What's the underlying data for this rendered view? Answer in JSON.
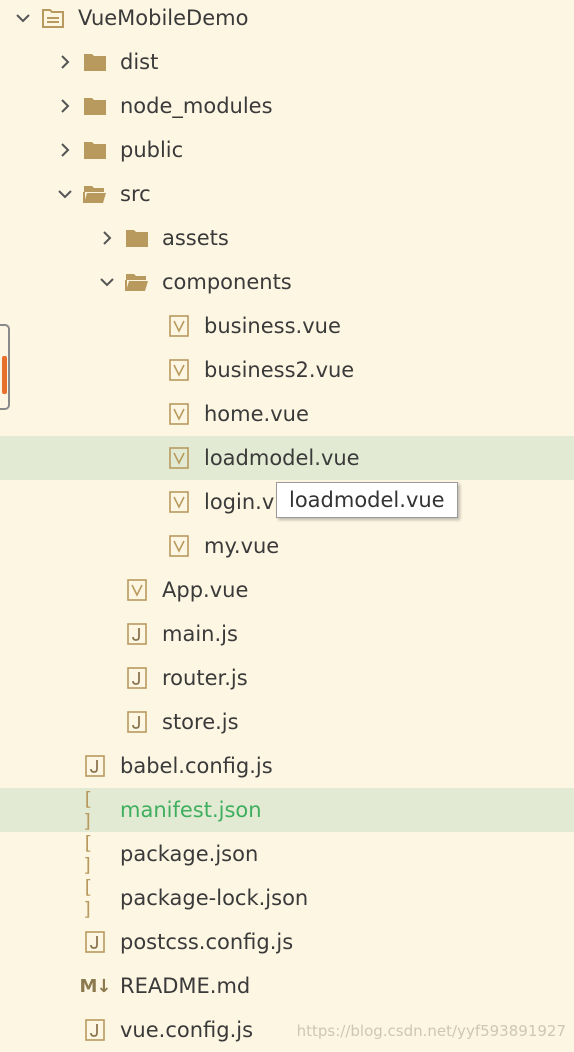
{
  "explorer": {
    "root": {
      "label": "VueMobileDemo",
      "expanded": true
    },
    "items": [
      {
        "label": "dist",
        "kind": "folder",
        "expanded": false
      },
      {
        "label": "node_modules",
        "kind": "folder",
        "expanded": false
      },
      {
        "label": "public",
        "kind": "folder",
        "expanded": false
      },
      {
        "label": "src",
        "kind": "folder",
        "expanded": true
      },
      {
        "label": "assets",
        "kind": "folder",
        "expanded": false
      },
      {
        "label": "components",
        "kind": "folder",
        "expanded": true
      },
      {
        "label": "business.vue",
        "kind": "vue"
      },
      {
        "label": "business2.vue",
        "kind": "vue"
      },
      {
        "label": "home.vue",
        "kind": "vue"
      },
      {
        "label": "loadmodel.vue",
        "kind": "vue",
        "hovered": true
      },
      {
        "label": "login.v",
        "kind": "vue"
      },
      {
        "label": "my.vue",
        "kind": "vue"
      },
      {
        "label": "App.vue",
        "kind": "vue"
      },
      {
        "label": "main.js",
        "kind": "js"
      },
      {
        "label": "router.js",
        "kind": "js"
      },
      {
        "label": "store.js",
        "kind": "js"
      },
      {
        "label": "babel.config.js",
        "kind": "js"
      },
      {
        "label": "manifest.json",
        "kind": "json",
        "selected": true
      },
      {
        "label": "package.json",
        "kind": "json"
      },
      {
        "label": "package-lock.json",
        "kind": "json"
      },
      {
        "label": "postcss.config.js",
        "kind": "js"
      },
      {
        "label": "README.md",
        "kind": "md"
      },
      {
        "label": "vue.config.js",
        "kind": "js"
      }
    ],
    "tooltip": "loadmodel.vue",
    "json_icon_glyph": "[ ]",
    "md_icon_glyph": "M↓"
  },
  "watermark": "https://blog.csdn.net/yyf593891927",
  "colors": {
    "background": "#fdf6e3",
    "highlight": "#e3ead3",
    "folder": "#b89a5e",
    "selected_text": "#3faf5f",
    "scroll_thumb": "#e8702a"
  }
}
